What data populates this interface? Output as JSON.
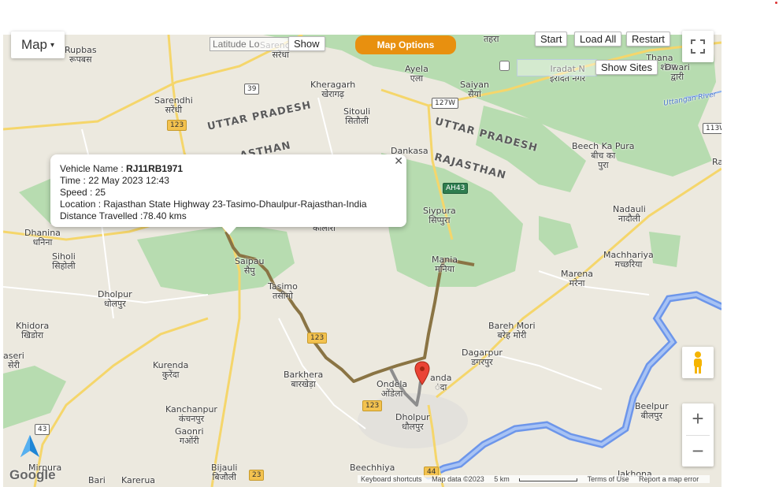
{
  "map_controls": {
    "map_type_label": "Map",
    "latitude_placeholder": "Latitude Lo",
    "show_label": "Show",
    "map_options_label": "Map Options",
    "start_label": "Start",
    "load_all_label": "Load All",
    "restart_label": "Restart",
    "show_sites_label": "Show Sites"
  },
  "info_window": {
    "vehicle_name_label": "Vehicle Name : ",
    "vehicle_name": "RJ11RB1971",
    "time": "Time : 22 May 2023 12:43",
    "speed": "Speed : 25",
    "location": "Location : Rajasthan State Highway 23-Tasimo-Dhaulpur-Rajasthan-India",
    "distance": "Distance Travelled :78.40 kms"
  },
  "states": {
    "up1": "UTTAR PRADESH",
    "up2": "UTTAR PRADESH",
    "rj1": "RAJASTHAN",
    "rj2": "ASTHAN"
  },
  "places": {
    "rupbas": "Rupbas\nरूपबस",
    "sarendhi": "Sarendhi\nसरेंधी",
    "sarendha": "Sarendha\nसरेंधा",
    "kheragarh": "Kheragarh\nखेरागढ़",
    "sitouli": "Sitouli\nसितौली",
    "ayela": "Ayela\nएला",
    "saiyan": "Saiyan\nसैयां",
    "tehra": "तहरा",
    "iradat": "Iradat N\nइरादत नगर",
    "thana": "Thana\nथाना शंकर",
    "dwari": "Dwari\nद्वारी",
    "beech_ka_pura": "Beech Ka Pura\nबीच का\nपुरा",
    "dankasa": "Dankasa",
    "siypura": "Siypura\nसिप्पुरा",
    "nadauli": "Nadauli\nनादौली",
    "dhanina": "Dhanina\nधनिना",
    "siholi": "Siholi\nसिहोली",
    "saipau": "Saipau\nसैपु",
    "mania": "Mania\nमनिया",
    "machhariya": "Machhariya\nमच्छरिया",
    "marena": "Marena\nमरेना",
    "dholpur_w": "Dholpur\nधोलपुर",
    "tasimo": "Tasimo\nतसीमो",
    "khidora": "Khidora\nखिडोरा",
    "bareh_mori": "Bareh Mori\nबरेह मोरी",
    "aseri": "aseri\nसेरी",
    "dagarpur": "Dagarpur\nडगरपुर",
    "kurenda": "Kurenda\nकुरेंदा",
    "barkhera": "Barkhera\nबारखेड़ा",
    "ondela": "Ondela\nओंडेला",
    "nanda": "anda\nंदा",
    "kanchanpur": "Kanchanpur\nकंचनपुर",
    "gaonri": "Gaonri\nगओंरी",
    "dholpur": "Dholpur\nधौलपुर",
    "beelpur": "Beelpur\nबीलपुर",
    "mirpura": "Mirpura",
    "bijauli": "Bijauli\nबिजौली",
    "beechhiya": "Beechhiya",
    "bari": "Bari",
    "karerua": "Karerua",
    "jakhona": "Jakhona",
    "kolari": "कोलारी",
    "uttangan_river": "Uttangan River",
    "ra": "Ra"
  },
  "road_shields": {
    "r39": "39",
    "r123a": "123",
    "r127w": "127W",
    "ah43": "AH43",
    "r113w": "113W",
    "r123b": "123",
    "r123c": "123",
    "r43": "43",
    "r23": "23",
    "r44": "44"
  },
  "footer": {
    "keyboard": "Keyboard shortcuts",
    "map_data": "Map data ©2023",
    "scale": "5 km",
    "terms": "Terms of Use",
    "report": "Report a map error"
  },
  "google_logo": "Google",
  "colors": {
    "map_options_bg": "#e8900f",
    "route_color": "#8a7444",
    "river_color": "#5f8ee8",
    "forest_color": "#a7d7a5"
  }
}
